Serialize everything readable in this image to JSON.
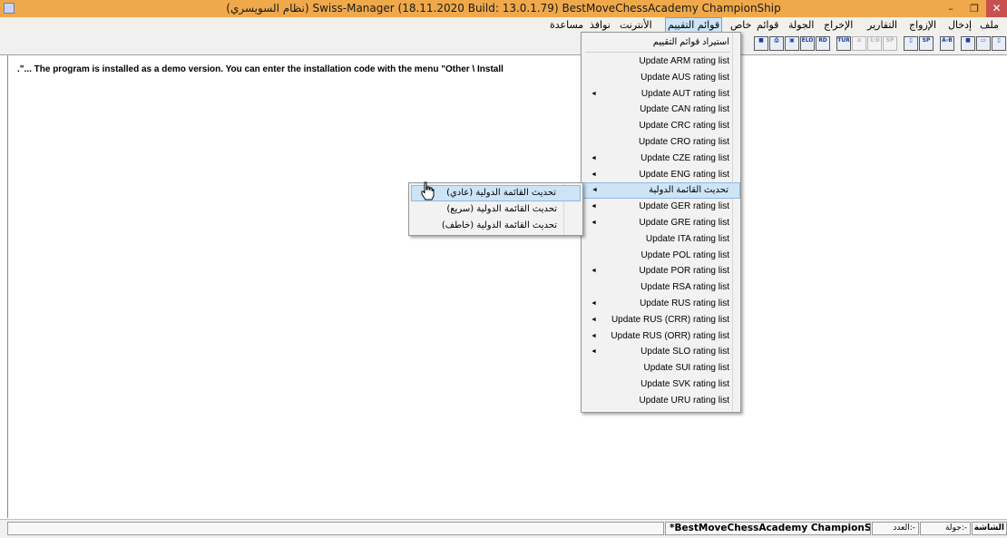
{
  "window": {
    "title": "(نظام السويسري)   Swiss-Manager (18.11.2020 Build: 13.0.1.79)  BestMoveChessAcademy ChampionShip",
    "minimize_glyph": "–",
    "maximize_glyph": "❐",
    "close_glyph": "✕"
  },
  "menubar": {
    "items": [
      "ملف",
      "إدخال",
      "الإزواج",
      "التقارير",
      "الإخراج",
      "الجولة",
      "قوائم",
      "خاص",
      "قوائم التقييم",
      "الأنترنت",
      "نوافذ",
      "مساعدة"
    ],
    "active": "قوائم التقييم"
  },
  "toolbar": {
    "buttons": [
      "new-file",
      "open-folder",
      "save",
      "a-b",
      "sp",
      "page",
      "sp-dim",
      "rr-dim",
      "list-dim",
      "tur",
      "rd",
      "elo",
      "screen",
      "print",
      "disk"
    ]
  },
  "main": {
    "demo_message": ".\"... The program is installed as a demo version. You can enter the installation code with the menu \"Other \\ Install"
  },
  "rating_menu": {
    "import_label": "استيراد قوائم التقييم",
    "items": [
      {
        "label": "Update ARM rating list",
        "submenu": false
      },
      {
        "label": "Update AUS rating list",
        "submenu": false
      },
      {
        "label": "Update AUT rating list",
        "submenu": true
      },
      {
        "label": "Update CAN rating list",
        "submenu": false
      },
      {
        "label": "Update CRC rating list",
        "submenu": false
      },
      {
        "label": "Update CRO rating list",
        "submenu": false
      },
      {
        "label": "Update CZE rating list",
        "submenu": true
      },
      {
        "label": "Update ENG rating list",
        "submenu": true
      },
      {
        "label": "تحديث القائمة الدولية",
        "submenu": true
      },
      {
        "label": "Update GER rating list",
        "submenu": true
      },
      {
        "label": "Update GRE rating list",
        "submenu": true
      },
      {
        "label": "Update ITA rating list",
        "submenu": false
      },
      {
        "label": "Update POL rating list",
        "submenu": false
      },
      {
        "label": "Update POR rating list",
        "submenu": true
      },
      {
        "label": "Update RSA rating list",
        "submenu": false
      },
      {
        "label": "Update RUS rating list",
        "submenu": true
      },
      {
        "label": "Update RUS (CRR) rating list",
        "submenu": true
      },
      {
        "label": "Update RUS (ORR) rating list",
        "submenu": true
      },
      {
        "label": "Update SLO rating list",
        "submenu": true
      },
      {
        "label": "Update SUI rating list",
        "submenu": false
      },
      {
        "label": "Update SVK rating list",
        "submenu": false
      },
      {
        "label": "Update URU rating list",
        "submenu": false
      }
    ],
    "highlighted": "تحديث القائمة الدولية"
  },
  "fide_submenu": {
    "items": [
      "تحديث القائمة الدولية (عادي)",
      "تحديث القائمة الدولية (سريع)",
      "تحديث القائمة الدولية (خاطف)"
    ],
    "highlighted": "تحديث القائمة الدولية (عادي)"
  },
  "statusbar": {
    "file": "*BestMoveChessAcademy ChampionShip.TUNx",
    "count": "العدد:-",
    "round": "جولة:-",
    "screen": "الشاشة"
  },
  "colors": {
    "titlebar": "#f0a94a",
    "close_button": "#c75050",
    "highlight": "#cde4f7",
    "menu_bg": "#f2f2f2"
  }
}
